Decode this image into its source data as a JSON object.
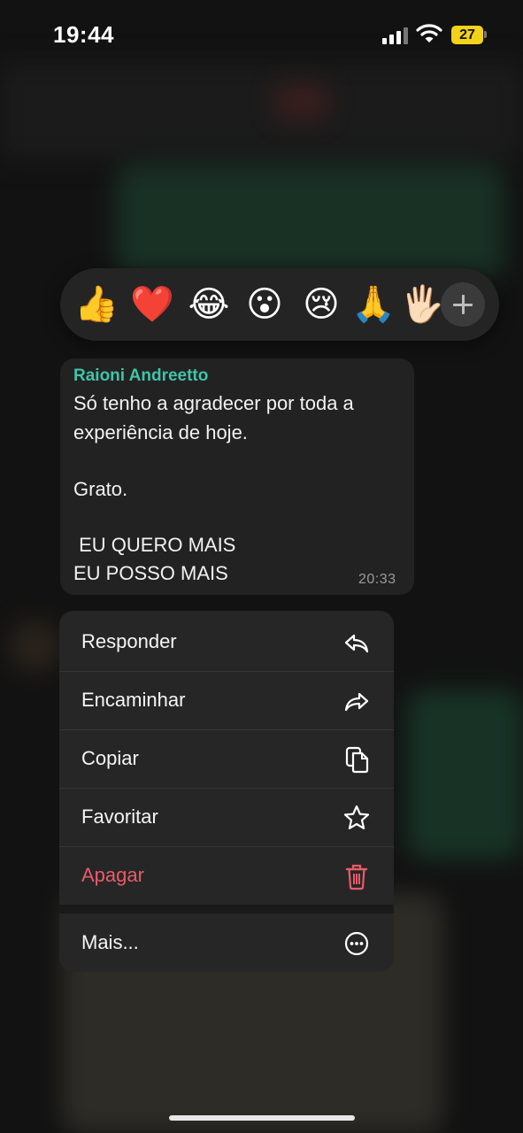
{
  "status_bar": {
    "time": "19:44",
    "battery": "27"
  },
  "reactions": [
    "👍",
    "❤️",
    "😂",
    "😮",
    "😢",
    "🙏",
    "🖐🏻"
  ],
  "message": {
    "sender": "Raioni Andreetto",
    "lines": [
      "Só tenho a agradecer por toda a",
      "experiência de hoje.",
      "Grato.",
      " EU QUERO MAIS",
      "EU POSSO MAIS"
    ],
    "time": "20:33"
  },
  "menu": {
    "reply": "Responder",
    "forward": "Encaminhar",
    "copy": "Copiar",
    "favorite": "Favoritar",
    "delete": "Apagar",
    "more": "Mais..."
  },
  "colors": {
    "sender": "#3fc4a8",
    "danger": "#ea5b6a",
    "battery": "#f3d21a"
  }
}
